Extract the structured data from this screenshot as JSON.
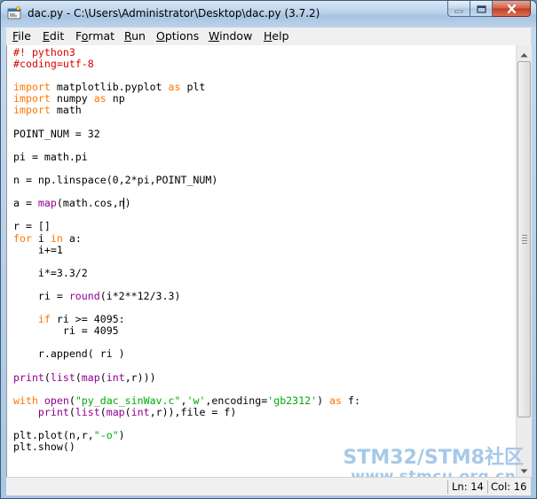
{
  "window": {
    "title": "dac.py - C:\\Users\\Administrator\\Desktop\\dac.py (3.7.2)"
  },
  "menubar": {
    "items": [
      {
        "label": "File",
        "mnemonic": "F"
      },
      {
        "label": "Edit",
        "mnemonic": "E"
      },
      {
        "label": "Format",
        "mnemonic": "o"
      },
      {
        "label": "Run",
        "mnemonic": "R"
      },
      {
        "label": "Options",
        "mnemonic": "O"
      },
      {
        "label": "Window",
        "mnemonic": "W"
      },
      {
        "label": "Help",
        "mnemonic": "H"
      }
    ]
  },
  "editor": {
    "lines": [
      [
        [
          "cm",
          "#! python3"
        ]
      ],
      [
        [
          "cm",
          "#coding=utf-8"
        ]
      ],
      [],
      [
        [
          "kw",
          "import"
        ],
        [
          "",
          " matplotlib.pyplot "
        ],
        [
          "kw",
          "as"
        ],
        [
          "",
          " plt"
        ]
      ],
      [
        [
          "kw",
          "import"
        ],
        [
          "",
          " numpy "
        ],
        [
          "kw",
          "as"
        ],
        [
          "",
          " np"
        ]
      ],
      [
        [
          "kw",
          "import"
        ],
        [
          "",
          " math"
        ]
      ],
      [],
      [
        [
          "",
          "POINT_NUM = 32"
        ]
      ],
      [],
      [
        [
          "",
          "pi = math.pi"
        ]
      ],
      [],
      [
        [
          "",
          "n = np.linspace(0,2*pi,POINT_NUM)"
        ]
      ],
      [],
      [
        [
          "",
          "a = "
        ],
        [
          "bi",
          "map"
        ],
        [
          "",
          "(math.cos,n)"
        ]
      ],
      [],
      [
        [
          "",
          "r = []"
        ]
      ],
      [
        [
          "kw",
          "for"
        ],
        [
          "",
          " i "
        ],
        [
          "kw",
          "in"
        ],
        [
          "",
          " a:"
        ]
      ],
      [
        [
          "",
          "    i+=1"
        ]
      ],
      [],
      [
        [
          "",
          "    i*=3.3/2"
        ]
      ],
      [],
      [
        [
          "",
          "    ri = "
        ],
        [
          "bi",
          "round"
        ],
        [
          "",
          "(i*2**12/3.3)"
        ]
      ],
      [],
      [
        [
          "",
          "    "
        ],
        [
          "kw",
          "if"
        ],
        [
          "",
          " ri >= 4095:"
        ]
      ],
      [
        [
          "",
          "        ri = 4095"
        ]
      ],
      [],
      [
        [
          "",
          "    r.append( ri )"
        ]
      ],
      [],
      [
        [
          "bi",
          "print"
        ],
        [
          "",
          "("
        ],
        [
          "bi",
          "list"
        ],
        [
          "",
          "("
        ],
        [
          "bi",
          "map"
        ],
        [
          "",
          "("
        ],
        [
          "bi",
          "int"
        ],
        [
          "",
          ",r)))"
        ]
      ],
      [],
      [
        [
          "kw",
          "with"
        ],
        [
          "",
          " "
        ],
        [
          "bi",
          "open"
        ],
        [
          "",
          "("
        ],
        [
          "st",
          "\"py_dac_sinWav.c\""
        ],
        [
          "",
          ","
        ],
        [
          "st",
          "'w'"
        ],
        [
          "",
          ",encoding="
        ],
        [
          "st",
          "'gb2312'"
        ],
        [
          "",
          ") "
        ],
        [
          "kw",
          "as"
        ],
        [
          "",
          " f:"
        ]
      ],
      [
        [
          "",
          "    "
        ],
        [
          "bi",
          "print"
        ],
        [
          "",
          "("
        ],
        [
          "bi",
          "list"
        ],
        [
          "",
          "("
        ],
        [
          "bi",
          "map"
        ],
        [
          "",
          "("
        ],
        [
          "bi",
          "int"
        ],
        [
          "",
          ",r)),file = f)"
        ]
      ],
      [],
      [
        [
          "",
          "plt.plot(n,r,"
        ],
        [
          "st",
          "\"-o\""
        ],
        [
          "",
          ")"
        ]
      ],
      [
        [
          "",
          "plt.show()"
        ]
      ]
    ]
  },
  "status": {
    "line": "Ln: 14",
    "col": "Col: 16"
  },
  "watermark": {
    "line1": "STM32/STM8社区",
    "line2": "www.stmcu.org.cn"
  },
  "icons": {
    "app": "idle-python-icon",
    "minimize": "minimize-icon",
    "maximize": "maximize-icon",
    "close": "close-icon"
  }
}
